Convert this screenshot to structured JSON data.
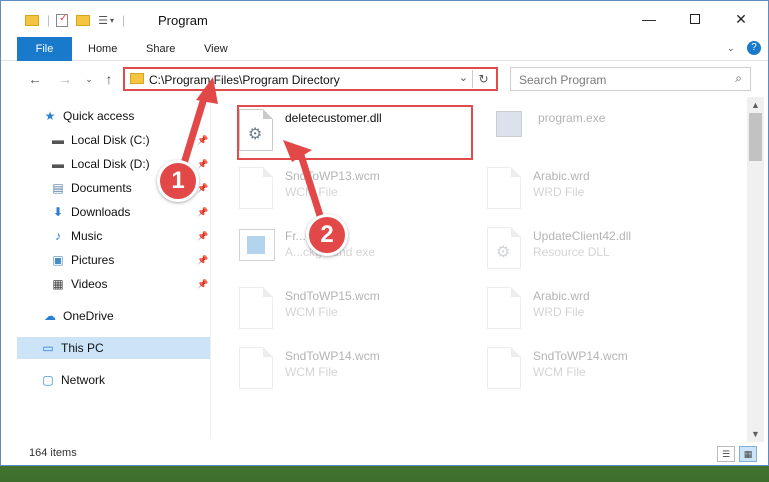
{
  "window": {
    "title": "Program"
  },
  "ribbon": {
    "tabs": [
      "File",
      "Home",
      "Share",
      "View"
    ]
  },
  "address": {
    "path": "C:\\Program Files\\Program Directory"
  },
  "search": {
    "placeholder": "Search Program"
  },
  "nav_pane": {
    "items": [
      {
        "label": "Quick access",
        "icon": "star-icon"
      },
      {
        "label": "Local Disk (C:)",
        "icon": "drive-icon",
        "pinned": true
      },
      {
        "label": "Local Disk (D:)",
        "icon": "drive-icon",
        "pinned": true
      },
      {
        "label": "Documents",
        "icon": "documents-icon",
        "pinned": true
      },
      {
        "label": "Downloads",
        "icon": "download-icon",
        "pinned": true
      },
      {
        "label": "Music",
        "icon": "music-icon",
        "pinned": true
      },
      {
        "label": "Pictures",
        "icon": "pictures-icon",
        "pinned": true
      },
      {
        "label": "Videos",
        "icon": "videos-icon",
        "pinned": true
      },
      {
        "label": "OneDrive",
        "icon": "cloud-icon"
      },
      {
        "label": "This PC",
        "icon": "computer-icon",
        "selected": true
      },
      {
        "label": "Network",
        "icon": "network-icon"
      }
    ]
  },
  "files": [
    {
      "name": "deletecustomer.dll",
      "desc": "",
      "highlighted": true
    },
    {
      "name": "program.exe",
      "desc": ""
    },
    {
      "name": "SndToWP13.wcm",
      "desc": "WCM File"
    },
    {
      "name": "Arabic.wrd",
      "desc": "WRD File"
    },
    {
      "name": "Fr...exe",
      "desc": "A...ckground exe"
    },
    {
      "name": "UpdateClient42.dll",
      "desc": "Resource DLL"
    },
    {
      "name": "SndToWP15.wcm",
      "desc": "WCM File"
    },
    {
      "name": "Arabic.wrd",
      "desc": "WRD File"
    },
    {
      "name": "SndToWP14.wcm",
      "desc": "WCM File"
    },
    {
      "name": "SndToWP14.wcm",
      "desc": "WCM File"
    }
  ],
  "status": {
    "item_count": "164 items"
  },
  "markers": [
    "1",
    "2"
  ],
  "colors": {
    "accent": "#1979ca",
    "annotation": "#e14b4b",
    "selected_bg": "#cce4f7"
  }
}
